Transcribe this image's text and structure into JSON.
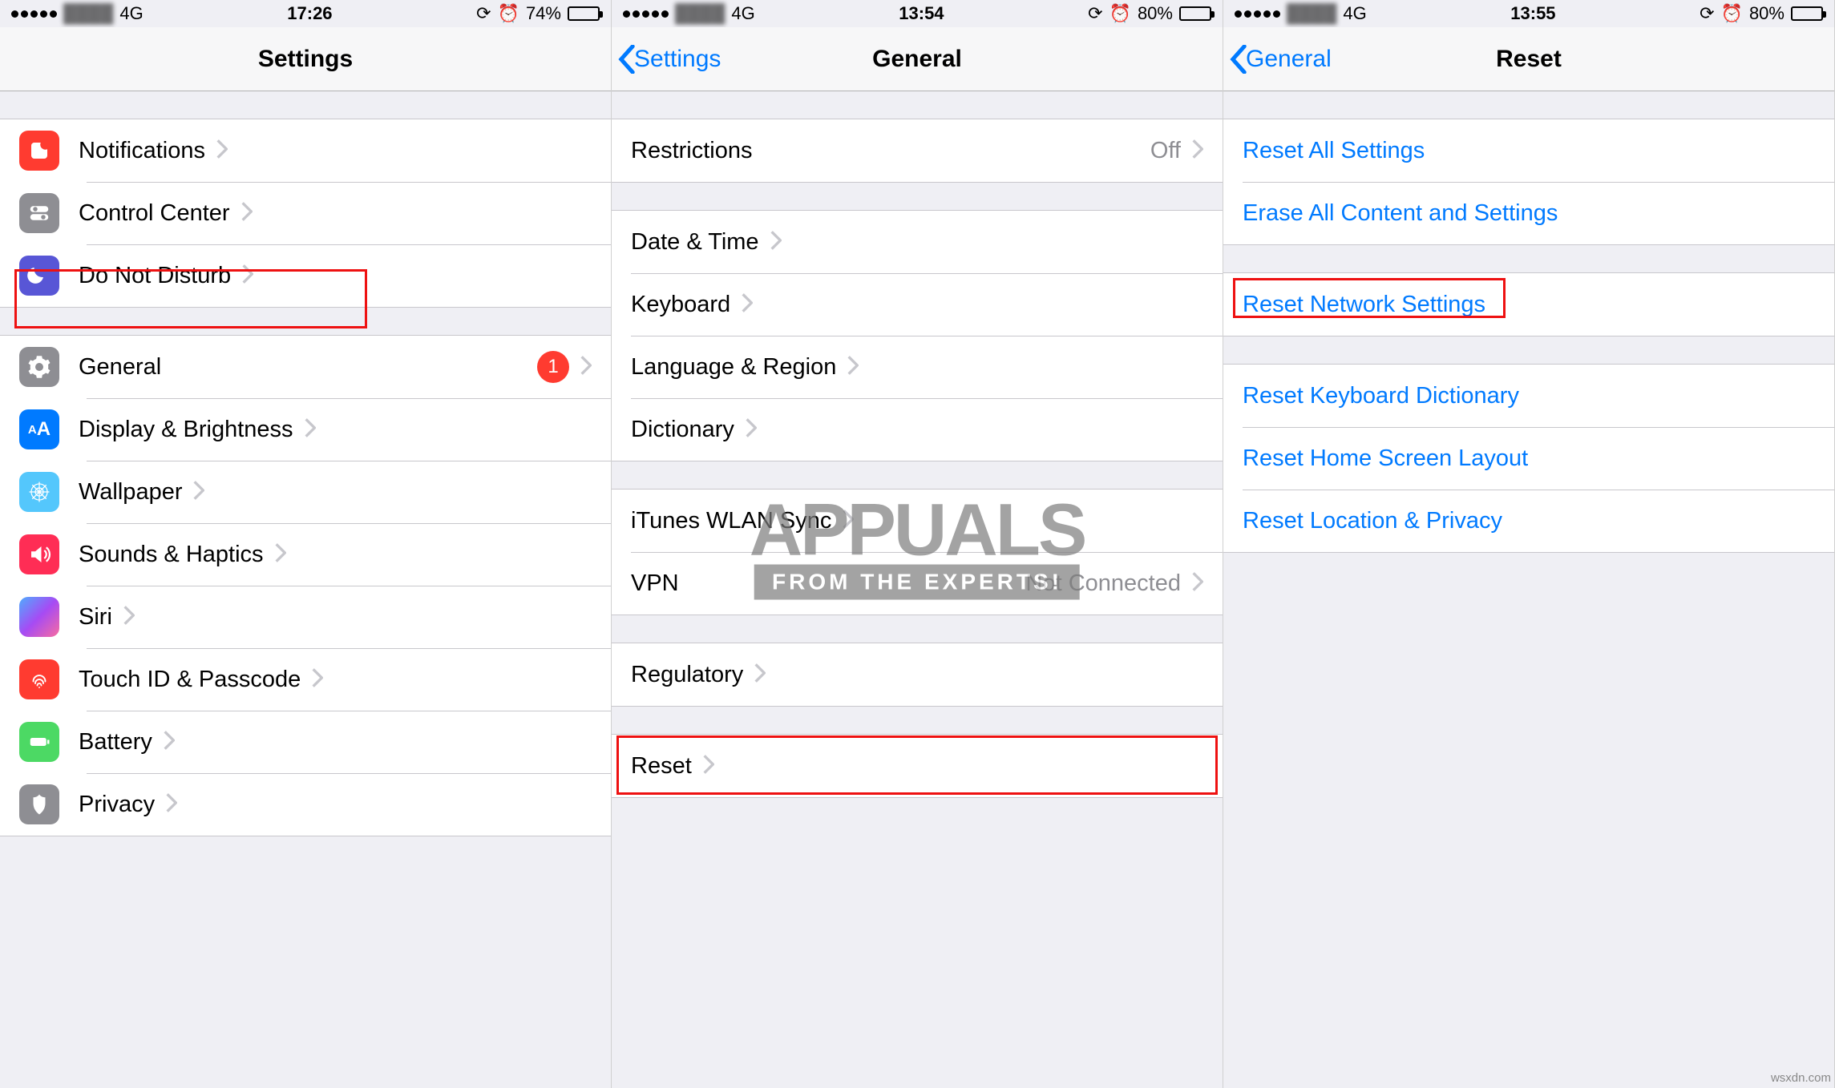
{
  "screens": [
    {
      "status": {
        "network": "4G",
        "time": "17:26",
        "battery_pct": "74%",
        "battery_fill": 74
      },
      "nav": {
        "title": "Settings",
        "back": null
      },
      "groups": [
        {
          "rows": [
            {
              "label": "Notifications",
              "icon": "notifications",
              "color": "#ff3b30"
            },
            {
              "label": "Control Center",
              "icon": "control-center",
              "color": "#8e8e93"
            },
            {
              "label": "Do Not Disturb",
              "icon": "do-not-disturb",
              "color": "#5856d6"
            }
          ]
        },
        {
          "rows": [
            {
              "label": "General",
              "icon": "general",
              "color": "#8e8e93",
              "badge": "1",
              "highlight": true
            },
            {
              "label": "Display & Brightness",
              "icon": "display",
              "color": "#007aff"
            },
            {
              "label": "Wallpaper",
              "icon": "wallpaper",
              "color": "#54c7fc"
            },
            {
              "label": "Sounds & Haptics",
              "icon": "sounds",
              "color": "#ff2d55"
            },
            {
              "label": "Siri",
              "icon": "siri",
              "color": "#000"
            },
            {
              "label": "Touch ID & Passcode",
              "icon": "touchid",
              "color": "#ff3b30"
            },
            {
              "label": "Battery",
              "icon": "battery",
              "color": "#4cd964"
            },
            {
              "label": "Privacy",
              "icon": "privacy",
              "color": "#8e8e93"
            }
          ]
        }
      ]
    },
    {
      "status": {
        "network": "4G",
        "time": "13:54",
        "battery_pct": "80%",
        "battery_fill": 80
      },
      "nav": {
        "title": "General",
        "back": "Settings"
      },
      "groups": [
        {
          "rows": [
            {
              "label": "Restrictions",
              "value": "Off"
            }
          ]
        },
        {
          "rows": [
            {
              "label": "Date & Time"
            },
            {
              "label": "Keyboard"
            },
            {
              "label": "Language & Region"
            },
            {
              "label": "Dictionary"
            }
          ]
        },
        {
          "rows": [
            {
              "label": "iTunes WLAN Sync"
            },
            {
              "label": "VPN",
              "value": "Not Connected"
            }
          ]
        },
        {
          "rows": [
            {
              "label": "Regulatory"
            }
          ]
        },
        {
          "rows": [
            {
              "label": "Reset",
              "highlight": true
            }
          ]
        }
      ],
      "watermark": {
        "big": "APPUALS",
        "small": "FROM THE EXPERTS!"
      }
    },
    {
      "status": {
        "network": "4G",
        "time": "13:55",
        "battery_pct": "80%",
        "battery_fill": 80
      },
      "nav": {
        "title": "Reset",
        "back": "General"
      },
      "groups": [
        {
          "rows": [
            {
              "label": "Reset All Settings",
              "blue": true,
              "no_chevron": true
            },
            {
              "label": "Erase All Content and Settings",
              "blue": true,
              "no_chevron": true
            }
          ]
        },
        {
          "rows": [
            {
              "label": "Reset Network Settings",
              "blue": true,
              "no_chevron": true,
              "highlight": true,
              "tight_highlight": true
            }
          ]
        },
        {
          "rows": [
            {
              "label": "Reset Keyboard Dictionary",
              "blue": true,
              "no_chevron": true
            },
            {
              "label": "Reset Home Screen Layout",
              "blue": true,
              "no_chevron": true
            },
            {
              "label": "Reset Location & Privacy",
              "blue": true,
              "no_chevron": true
            }
          ]
        }
      ]
    }
  ],
  "source_note": "wsxdn.com"
}
